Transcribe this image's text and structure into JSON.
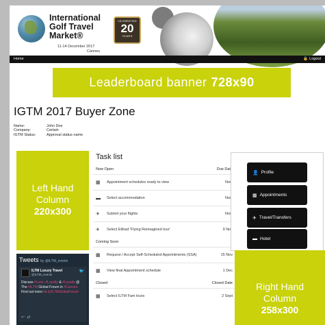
{
  "header": {
    "brand_line1": "International",
    "brand_line2": "Golf Travel",
    "brand_line3": "Market®",
    "dates": "11-14 December 2017",
    "city": "Cannes",
    "badge_top": "CELEBRATING",
    "badge_number": "20",
    "badge_bottom": "YEARS"
  },
  "nav": {
    "home": "Home",
    "logout": "Logout"
  },
  "leaderboard": {
    "label": "Leaderboard banner",
    "size": "728x90"
  },
  "page_title": "IGTM 2017 Buyer Zone",
  "user_info": [
    {
      "key": "Name:",
      "value": "John Doe"
    },
    {
      "key": "Company:",
      "value": "Certain"
    },
    {
      "key": "IGTM Status:",
      "value": "Approval status name"
    }
  ],
  "left_column": {
    "line1": "Left Hand",
    "line2": "Column",
    "size": "220x300"
  },
  "tweets": {
    "title": "Tweets",
    "by": "by @ILTM_events",
    "name": "ILTM Luxury Travel",
    "handle": "@ILTM_events",
    "text_a": "Discuss ",
    "text_b": "#Luxe, #Loyalty",
    "text_c": " & ",
    "text_d": "#Loyalty",
    "text_e": " @ The ",
    "text_f": "#ILTM",
    "text_g": " Global Forum in ",
    "text_h": "#Cannes",
    "text_i": " Find out more ",
    "text_j": "bit.ly/ILTMGlobalForum"
  },
  "task_list": {
    "title": "Task list",
    "sections": [
      {
        "name": "Now Open",
        "date_header": "Due Date",
        "rows": [
          {
            "icon": "calendar-icon",
            "label": "Appointment schedules ready to view",
            "date": "Now"
          },
          {
            "icon": "bed-icon",
            "label": "Select accommodation",
            "date": "Now"
          },
          {
            "icon": "plane-icon",
            "label": "Submit your flights",
            "date": "Now"
          },
          {
            "icon": "plane-icon",
            "label": "Select Etihad 'Flying Reimagined tour'",
            "date": "9 Nov"
          }
        ]
      },
      {
        "name": "Coming Soon",
        "date_header": "",
        "rows": [
          {
            "icon": "calendar-icon",
            "label": "Request / Accept Self-Scheduled Appointments (SSA)",
            "date": "15 Nov"
          },
          {
            "icon": "calendar-icon",
            "label": "View final Appointment schedule",
            "date": "1 Dec"
          }
        ]
      },
      {
        "name": "Closed",
        "date_header": "Closed Date",
        "rows": [
          {
            "icon": "calendar-icon",
            "label": "Select ILTM Fam tours",
            "date": "2 Sept"
          }
        ]
      }
    ]
  },
  "side_buttons": [
    {
      "icon": "user-icon",
      "label": "Profile"
    },
    {
      "icon": "calendar-icon",
      "label": "Appointments"
    },
    {
      "icon": "plane-icon",
      "label": "Travel/Transfers"
    },
    {
      "icon": "bed-icon",
      "label": "Hotel"
    }
  ],
  "right_column": {
    "line1": "Right Hand",
    "line2": "Column",
    "size": "258x300"
  },
  "colors": {
    "accent": "#c9d20a",
    "nav": "#111111",
    "tweet_bg": "#1e2a35"
  }
}
